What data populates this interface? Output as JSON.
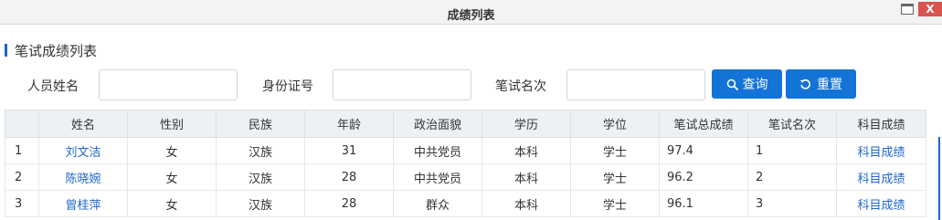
{
  "window": {
    "title": "成绩列表",
    "close_label": "X"
  },
  "section": {
    "title": "笔试成绩列表"
  },
  "filters": {
    "name_label": "人员姓名",
    "name_value": "",
    "id_label": "身份证号",
    "id_value": "",
    "rank_label": "笔试名次",
    "rank_value": ""
  },
  "buttons": {
    "search_label": "查询",
    "reset_label": "重置"
  },
  "table": {
    "columns": [
      "",
      "姓名",
      "性别",
      "民族",
      "年龄",
      "政治面貌",
      "学历",
      "学位",
      "笔试总成绩",
      "笔试名次",
      "科目成绩"
    ],
    "rows": [
      {
        "index": "1",
        "name": "刘文洁",
        "gender": "女",
        "ethnicity": "汉族",
        "age": "31",
        "political": "中共党员",
        "education": "本科",
        "degree": "学士",
        "score": "97.4",
        "rank": "1",
        "subject_link": "科目成绩"
      },
      {
        "index": "2",
        "name": "陈晓婉",
        "gender": "女",
        "ethnicity": "汉族",
        "age": "28",
        "political": "中共党员",
        "education": "本科",
        "degree": "学士",
        "score": "96.2",
        "rank": "2",
        "subject_link": "科目成绩"
      },
      {
        "index": "3",
        "name": "曾桂萍",
        "gender": "女",
        "ethnicity": "汉族",
        "age": "28",
        "political": "群众",
        "education": "本科",
        "degree": "学士",
        "score": "96.1",
        "rank": "3",
        "subject_link": "科目成绩"
      }
    ]
  },
  "colors": {
    "accent": "#1373d6",
    "link": "#1d66c9",
    "header_bg": "#eef1f4",
    "close_bg": "#d9534f"
  }
}
